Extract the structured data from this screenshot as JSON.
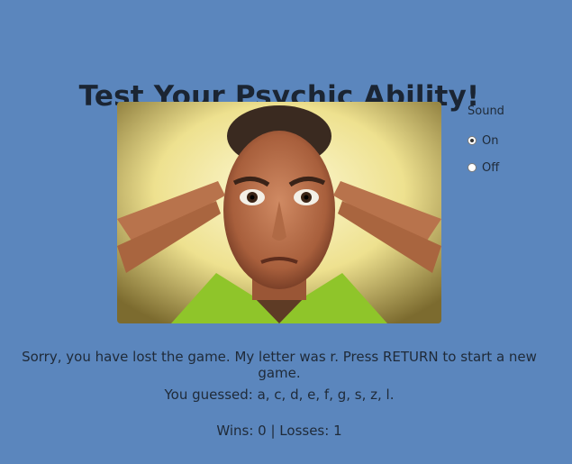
{
  "page": {
    "title": "Test Your Psychic Ability!"
  },
  "sound": {
    "label": "Sound",
    "options": [
      {
        "label": "On",
        "selected": true
      },
      {
        "label": "Off",
        "selected": false
      }
    ]
  },
  "game": {
    "message": "Sorry, you have lost the game. My letter was r. Press RETURN to start a new game.",
    "guessed": "You guessed: a, c, d, e, f, g, s, z, l.",
    "score": "Wins: 0 | Losses: 1"
  },
  "colors": {
    "background": "#5b86bd",
    "text": "#1f2a38"
  }
}
